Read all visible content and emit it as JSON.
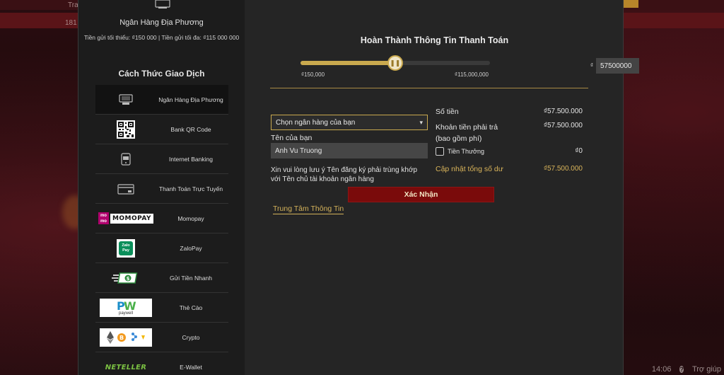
{
  "backdrop": {
    "tiny_text_1": "Tra",
    "tiny_text_2": "181",
    "bottom_right_text_1": "14:06",
    "bottom_right_text_2": "Trợ giúp"
  },
  "selected_method": {
    "name": "Ngân Hàng Địa Phương",
    "limits": "Tiền gửi tối thiểu: ₫150 000 | Tiền gửi tối đa: ₫115 000 000"
  },
  "methods_title": "Cách Thức Giao Dịch",
  "methods": [
    {
      "label": "Ngân Hàng Địa Phương",
      "icon": "bank-card-icon",
      "active": true
    },
    {
      "label": "Bank QR Code",
      "icon": "qr-code-icon",
      "active": false
    },
    {
      "label": "Internet Banking",
      "icon": "phone-banking-icon",
      "active": false
    },
    {
      "label": "Thanh Toán Trực Tuyến",
      "icon": "online-payment-icon",
      "active": false
    },
    {
      "label": "Momopay",
      "icon": "momo-logo",
      "logo_text": "MOMOPAY",
      "badge": "mo mo",
      "active": false
    },
    {
      "label": "ZaloPay",
      "icon": "zalopay-logo",
      "logo_text": "Zalo Pay",
      "active": false
    },
    {
      "label": "Gửi Tiền Nhanh",
      "icon": "fast-money-icon",
      "active": false
    },
    {
      "label": "Thẻ Cào",
      "icon": "paywell-logo",
      "logo_text": "paywell",
      "active": false
    },
    {
      "label": "Crypto",
      "icon": "crypto-coins-icon",
      "active": false
    },
    {
      "label": "E-Wallet",
      "icon": "neteller-logo",
      "logo_text": "NETELLER",
      "active": false
    }
  ],
  "form": {
    "title": "Hoàn Thành Thông Tin Thanh Toán",
    "slider": {
      "min_label": "₫150,000",
      "max_label": "₫115,000,000",
      "min_value": 150000,
      "max_value": 115000000,
      "value": 57500000
    },
    "amount_currency": "₫",
    "amount_value": "57500000",
    "bank_select_value": "Chọn ngân hàng của bạn",
    "name_label": "Tên của bạn",
    "name_value": "Anh Vu Truong",
    "notice": "Xin vui lòng lưu ý Tên đăng ký phải trùng khớp với Tên chủ tài khoản ngân hàng",
    "info_link": "Trung Tâm Thông Tin"
  },
  "summary": {
    "amount_label": "Số tiền",
    "amount_value": "₫57.500.000",
    "payable_label_1": "Khoản tiền phải trả",
    "payable_label_2": "(bao gồm phí)",
    "payable_value": "₫57.500.000",
    "bonus_label": "Tiền Thưởng",
    "bonus_value": "₫0",
    "balance_label": "Cập nhật tổng số dư",
    "balance_value": "₫57.500.000"
  },
  "confirm_label": "Xác Nhận",
  "colors": {
    "accent_gold": "#c9a94e",
    "confirm_red": "#7a0b0b"
  }
}
